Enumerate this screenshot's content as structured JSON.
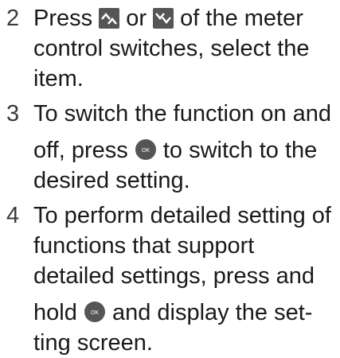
{
  "steps": [
    {
      "number": "2",
      "lines": [
        {
          "before": "Press ",
          "icon1": "meter-up-switch-icon",
          "mid": " or ",
          "icon2": "meter-down-switch-icon",
          "after": " of the meter"
        },
        "control switches, select the",
        "item."
      ]
    },
    {
      "number": "3",
      "lines": [
        "To switch the function on and",
        {
          "before": "off, press ",
          "icon": "ok-button-icon",
          "after": " to switch to the"
        },
        "desired setting."
      ]
    },
    {
      "number": "4",
      "lines": [
        "To perform detailed setting of",
        "functions that support",
        "detailed settings, press and",
        {
          "before": "hold ",
          "icon": "ok-button-icon",
          "after": " and display the set-"
        },
        "ting screen."
      ]
    }
  ],
  "colors": {
    "text": "#1a1a1a",
    "icon": "#555555"
  }
}
